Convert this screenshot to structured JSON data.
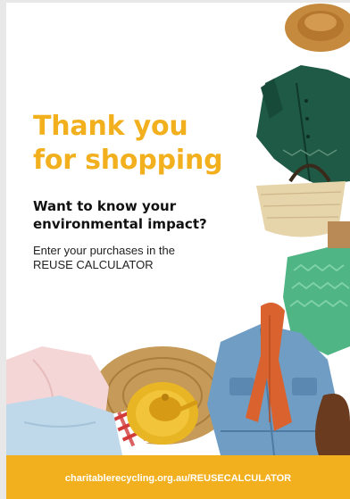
{
  "poster": {
    "headline_line1": "Thank you",
    "headline_line2": "for shopping",
    "subhead_line1": "Want to know your",
    "subhead_line2": "environmental impact?",
    "instruction_line1": "Enter your purchases in the",
    "instruction_line2": "REUSE CALCULATOR",
    "footer_url": "charitablerecycling.org.au/REUSECALCULATOR"
  },
  "colors": {
    "accent": "#f2b01e",
    "text_dark": "#111111",
    "footer_text": "#ffffff"
  },
  "illustration": {
    "items": [
      "straw-hat",
      "green-blouse",
      "woven-handbag",
      "green-knit-jumper",
      "denim-jacket",
      "orange-scarf",
      "yellow-teapot",
      "wicker-placemat",
      "red-checked-cloth",
      "pink-pants",
      "blue-shirt",
      "leather-shoe"
    ]
  }
}
